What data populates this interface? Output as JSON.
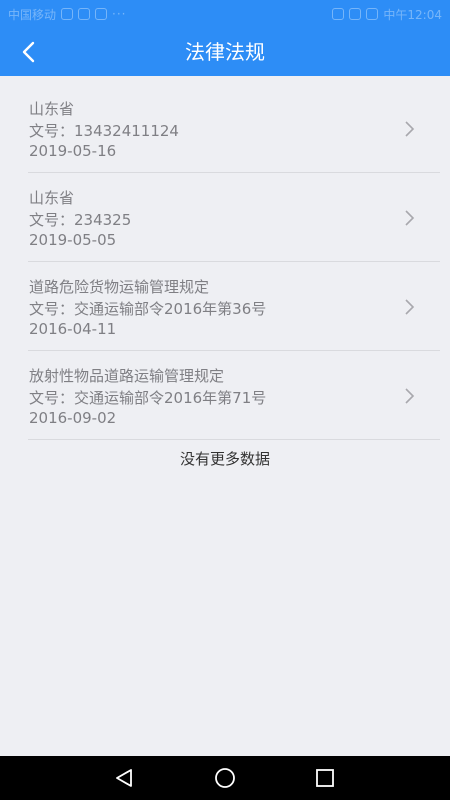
{
  "status_bar": {
    "carrier": "中国移动",
    "time": "中午12:04"
  },
  "header": {
    "title": "法律法规"
  },
  "items": [
    {
      "title": "山东省",
      "doc_number": "文号：13432411124",
      "date": "2019-05-16"
    },
    {
      "title": "山东省",
      "doc_number": "文号：234325",
      "date": "2019-05-05"
    },
    {
      "title": "道路危险货物运输管理规定",
      "doc_number": "文号：交通运输部令2016年第36号",
      "date": "2016-04-11"
    },
    {
      "title": "放射性物品道路运输管理规定",
      "doc_number": "文号：交通运输部令2016年第71号",
      "date": "2016-09-02"
    }
  ],
  "footer": {
    "no_more_text": "没有更多数据"
  },
  "colors": {
    "accent": "#2d8df6",
    "background": "#eeeff3",
    "secondary_text": "#7f7f84"
  }
}
